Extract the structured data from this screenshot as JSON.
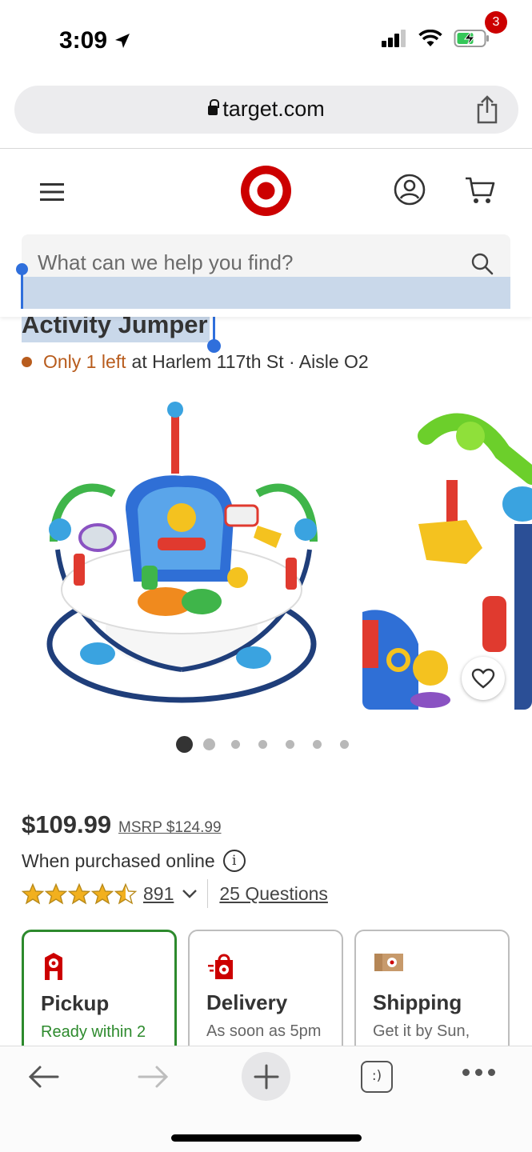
{
  "status": {
    "time": "3:09"
  },
  "browser": {
    "url": "target.com"
  },
  "header": {
    "cart_count": "3"
  },
  "search": {
    "placeholder": "What can we help you find?"
  },
  "product": {
    "title": "Activity Jumper",
    "stock_warning": "Only 1 left",
    "stock_location": "at Harlem 117th St · Aisle O2",
    "price": "$109.99",
    "msrp": "MSRP $124.99",
    "price_note": "When purchased online",
    "rating": 4.5,
    "review_count": "891",
    "questions": "25 Questions",
    "image_count": 7,
    "current_image": 1
  },
  "fulfillment": [
    {
      "title": "Pickup",
      "subtitle": "Ready within 2",
      "selected": true
    },
    {
      "title": "Delivery",
      "subtitle": "As soon as 5pm",
      "selected": false
    },
    {
      "title": "Shipping",
      "subtitle": "Get it by Sun,",
      "selected": false
    }
  ],
  "colors": {
    "brand": "#cc0000",
    "selected_green": "#2d8a2d",
    "stock_orange": "#b85c1d",
    "star_gold": "#f2b01e",
    "selection_blue": "#2f6fdc"
  },
  "toolbar": {
    "tabs_glyph": ":)"
  }
}
